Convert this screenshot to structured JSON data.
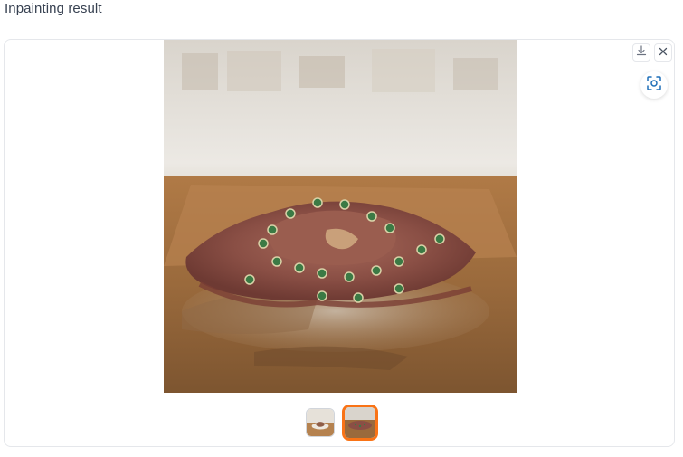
{
  "section": {
    "title": "Inpainting result"
  },
  "toolbar": {
    "download_icon": "download-icon",
    "close_icon": "close-icon",
    "fullscreen_icon": "fullscreen-focus-icon"
  },
  "gallery": {
    "main_image_alt": "",
    "thumbnails": [
      {
        "selected": false
      },
      {
        "selected": true
      }
    ],
    "accent_color": "#f97316"
  }
}
